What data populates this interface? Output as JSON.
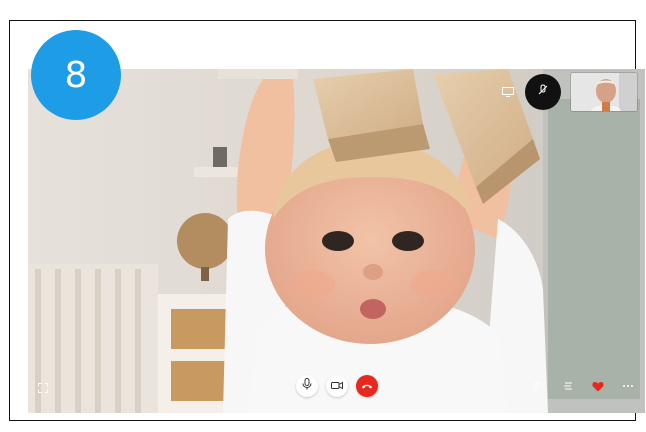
{
  "step_badge": {
    "label": "8",
    "color": "#1f9ce6"
  },
  "call": {
    "remote_video": "baby-with-wooden-blocks",
    "self_view": "elderly-man-portrait"
  },
  "controls": {
    "top": [
      "screen-share-icon",
      "mute-contact-icon"
    ],
    "bottom_center": [
      "microphone-icon",
      "camera-icon",
      "end-call-icon"
    ],
    "bottom_left": [
      "fullscreen-icon"
    ],
    "bottom_right": [
      "chat-icon",
      "list-icon",
      "heart-icon",
      "more-icon"
    ]
  },
  "colors": {
    "end_call": "#e8281e",
    "heart": "#e8281e",
    "mute_circle": "#111111"
  }
}
